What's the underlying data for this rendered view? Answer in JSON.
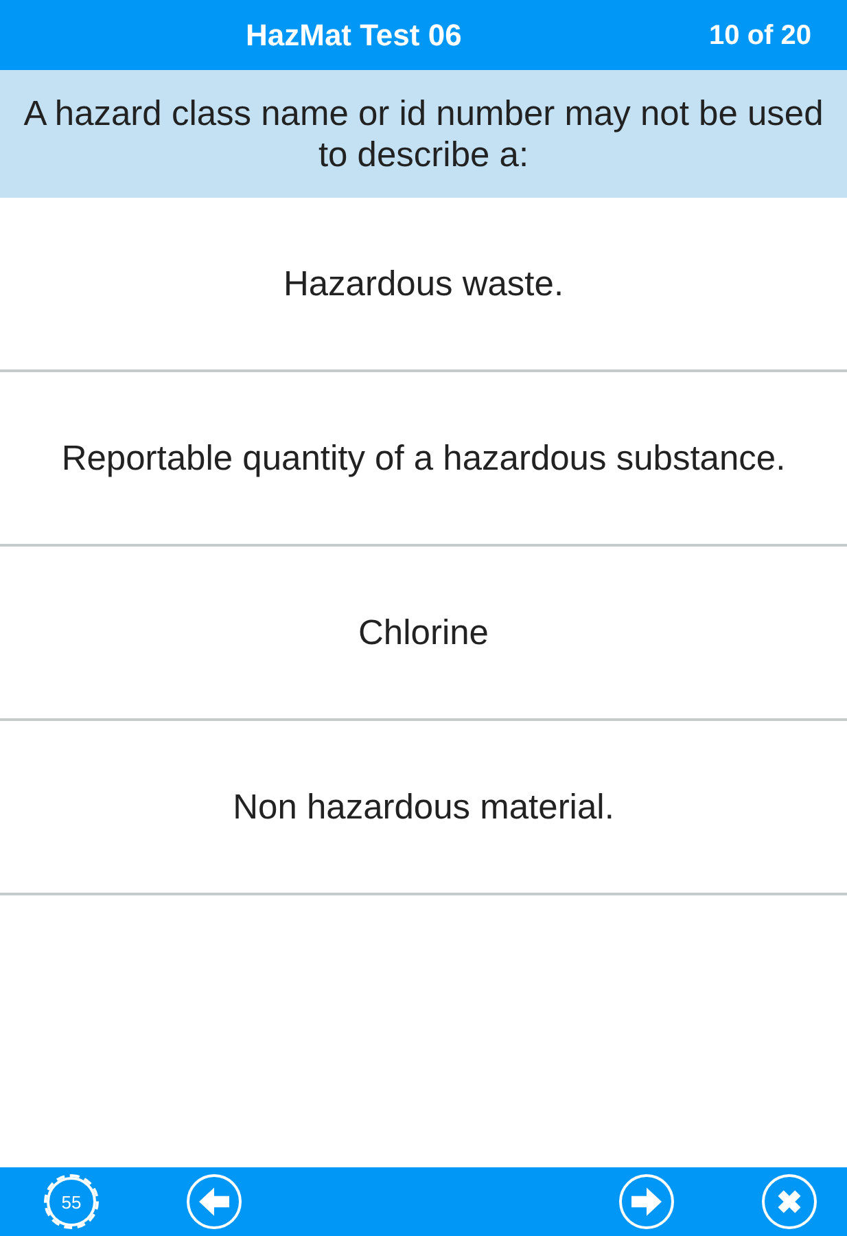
{
  "header": {
    "title": "HazMat Test 06",
    "progress": "10 of 20"
  },
  "question": "A hazard class name or id number may not be used to describe a:",
  "answers": [
    {
      "text": "Hazardous waste.",
      "selected": false
    },
    {
      "text": "Reportable quantity of a hazardous substance.",
      "selected": false
    },
    {
      "text": "Chlorine",
      "selected": false
    },
    {
      "text": "Non hazardous material.",
      "selected": false
    }
  ],
  "footer": {
    "timer": "55",
    "left": [
      {
        "kind": "back"
      }
    ],
    "right": [
      {
        "kind": "next"
      },
      {
        "kind": "close"
      }
    ]
  }
}
